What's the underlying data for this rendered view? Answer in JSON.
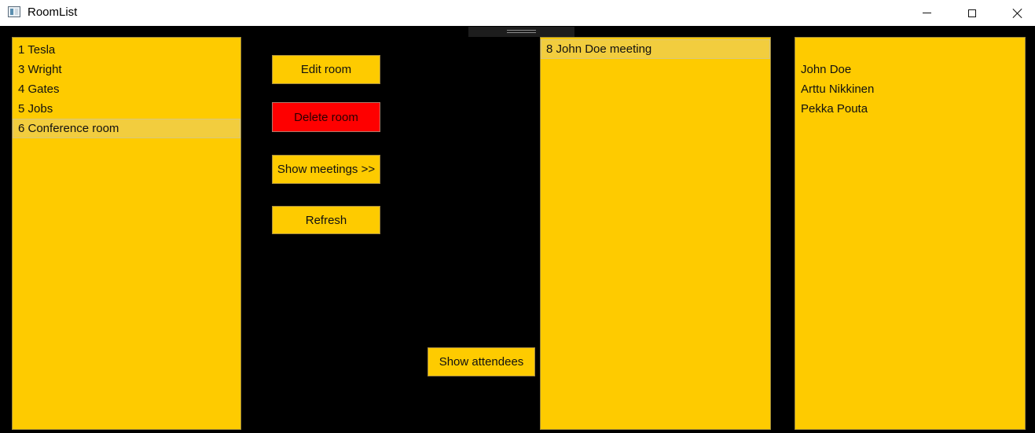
{
  "window": {
    "title": "RoomList"
  },
  "rooms": {
    "items": [
      {
        "label": "1 Tesla"
      },
      {
        "label": "3 Wright"
      },
      {
        "label": "4 Gates"
      },
      {
        "label": "5 Jobs"
      },
      {
        "label": "6 Conference room",
        "selected": true
      }
    ]
  },
  "actions": {
    "edit_room": "Edit room",
    "delete_room": "Delete room",
    "show_meetings": "Show meetings >>",
    "refresh": "Refresh",
    "show_attendees": "Show attendees"
  },
  "meetings": {
    "items": [
      {
        "label": "8 John Doe meeting",
        "selected": true
      }
    ]
  },
  "attendees": {
    "items": [
      {
        "label": "John Doe"
      },
      {
        "label": "Arttu Nikkinen"
      },
      {
        "label": "Pekka Pouta"
      }
    ]
  },
  "colors": {
    "background": "#000000",
    "list_background": "#fecb00",
    "danger": "#fe0000",
    "selection": "#f2cd3e"
  },
  "icons": {
    "app": "window-app-icon",
    "minimize": "minimize-icon",
    "maximize": "maximize-icon",
    "close": "close-icon"
  }
}
